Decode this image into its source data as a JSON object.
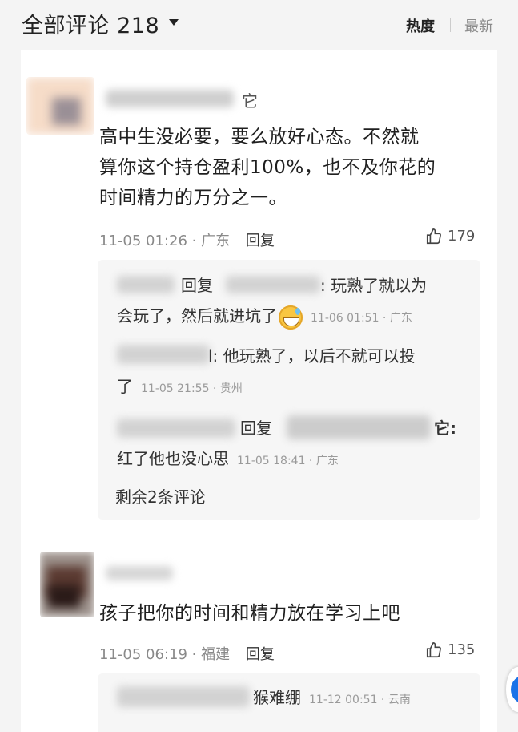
{
  "header": {
    "title": "全部评论 218",
    "sort_hot": "热度",
    "sort_new": "最新"
  },
  "comments": [
    {
      "username_visible_fragment": "它",
      "text_lines": [
        "高中生没必要，要么放好心态。不然就",
        "算你这个持仓盈利100%，也不及你花的",
        "时间精力的万分之一。"
      ],
      "time": "11-05 01:26",
      "location": "广东",
      "reply_label": "回复",
      "likes": "179",
      "replies": [
        {
          "reply_word": "回复",
          "line1_tail": ": 玩熟了就以为",
          "line2": "会玩了，然后就进坑了",
          "emoji": "grinning-sweat-emoji",
          "time_loc": "11-06 01:51 · 广东"
        },
        {
          "line1_tail": "l: 他玩熟了，以后不就可以投",
          "line2": "了",
          "time_loc": "11-05 21:55 · 贵州"
        },
        {
          "reply_word": "回复",
          "line1_tail": "它:",
          "line2": "红了他也没心思",
          "time_loc": "11-05 18:41 · 广东"
        }
      ],
      "more_replies": "剩余2条评论"
    },
    {
      "text_lines": [
        "孩子把你的时间和精力放在学习上吧"
      ],
      "time": "11-05 06:19",
      "location": "福建",
      "reply_label": "回复",
      "likes": "135",
      "replies": [
        {
          "line1_tail": "猴难绷",
          "time_loc": "11-12 00:51 · 云南"
        }
      ]
    }
  ],
  "colors": {
    "accent": "#1a73e8",
    "text": "#1f1f1f",
    "meta": "#8a8a8a",
    "subbox_bg": "#f6f6f6"
  }
}
